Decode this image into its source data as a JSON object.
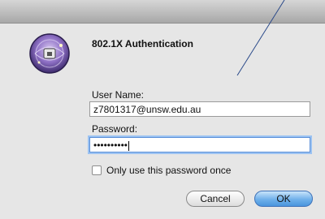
{
  "dialog": {
    "title": "802.1X Authentication",
    "username_label": "User Name:",
    "username_value": "z7801317@unsw.edu.au",
    "password_label": "Password:",
    "password_masked": "••••••••••",
    "checkbox_label": "Only use this password once",
    "checkbox_checked": false,
    "cancel_label": "Cancel",
    "ok_label": "OK"
  },
  "colors": {
    "dialog_background": "#e6e6e6",
    "focus_ring": "#9cc3f2",
    "default_button": "#6fb0ea"
  },
  "icons": {
    "app_icon": "network-wireless-lock-icon"
  }
}
